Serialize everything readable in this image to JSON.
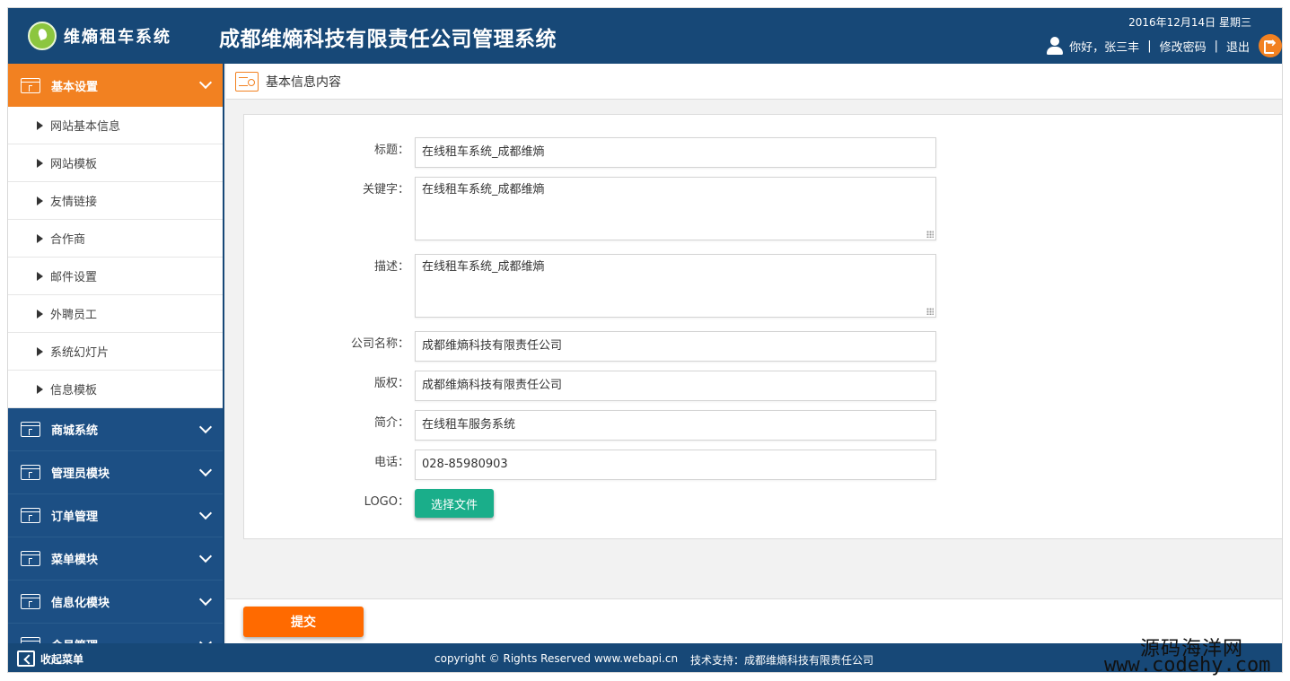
{
  "header": {
    "logo_text": "维熵租车系统",
    "system_title": "成都维熵科技有限责任公司管理系统",
    "date": "2016年12月14日 星期三",
    "greeting": "你好，张三丰",
    "separator": "|",
    "change_password": "修改密码",
    "logout": "退出"
  },
  "sidebar": {
    "groups": [
      {
        "label": "基本设置",
        "active": true
      },
      {
        "label": "商城系统"
      },
      {
        "label": "管理员模块"
      },
      {
        "label": "订单管理"
      },
      {
        "label": "菜单模块"
      },
      {
        "label": "信息化模块"
      },
      {
        "label": "会员管理"
      }
    ],
    "sub_items": [
      "网站基本信息",
      "网站模板",
      "友情链接",
      "合作商",
      "邮件设置",
      "外聘员工",
      "系统幻灯片",
      "信息模板"
    ]
  },
  "main": {
    "title": "基本信息内容",
    "form": {
      "title_label": "标题：",
      "title_value": "在线租车系统_成都维熵",
      "keywords_label": "关键字：",
      "keywords_value": "在线租车系统_成都维熵",
      "desc_label": "描述：",
      "desc_value": "在线租车系统_成都维熵",
      "company_label": "公司名称：",
      "company_value": "成都维熵科技有限责任公司",
      "copyright_label": "版权：",
      "copyright_value": "成都维熵科技有限责任公司",
      "intro_label": "简介：",
      "intro_value": "在线租车服务系统",
      "phone_label": "电话：",
      "phone_value": "028-85980903",
      "logo_label": "LOGO：",
      "file_button": "选择文件"
    },
    "submit_button": "提交"
  },
  "footer": {
    "collapse_menu": "收起菜单",
    "copyright": "copyright © Rights Reserved www.webapi.cn",
    "support": "技术支持：成都维熵科技有限责任公司"
  },
  "watermark": {
    "line1": "源码海洋网",
    "line2": "www.codehy.com"
  },
  "colors": {
    "header_blue": "#174877",
    "accent_orange": "#f28121",
    "submit_orange": "#ff6a00",
    "file_button_green": "#1aae8a"
  }
}
